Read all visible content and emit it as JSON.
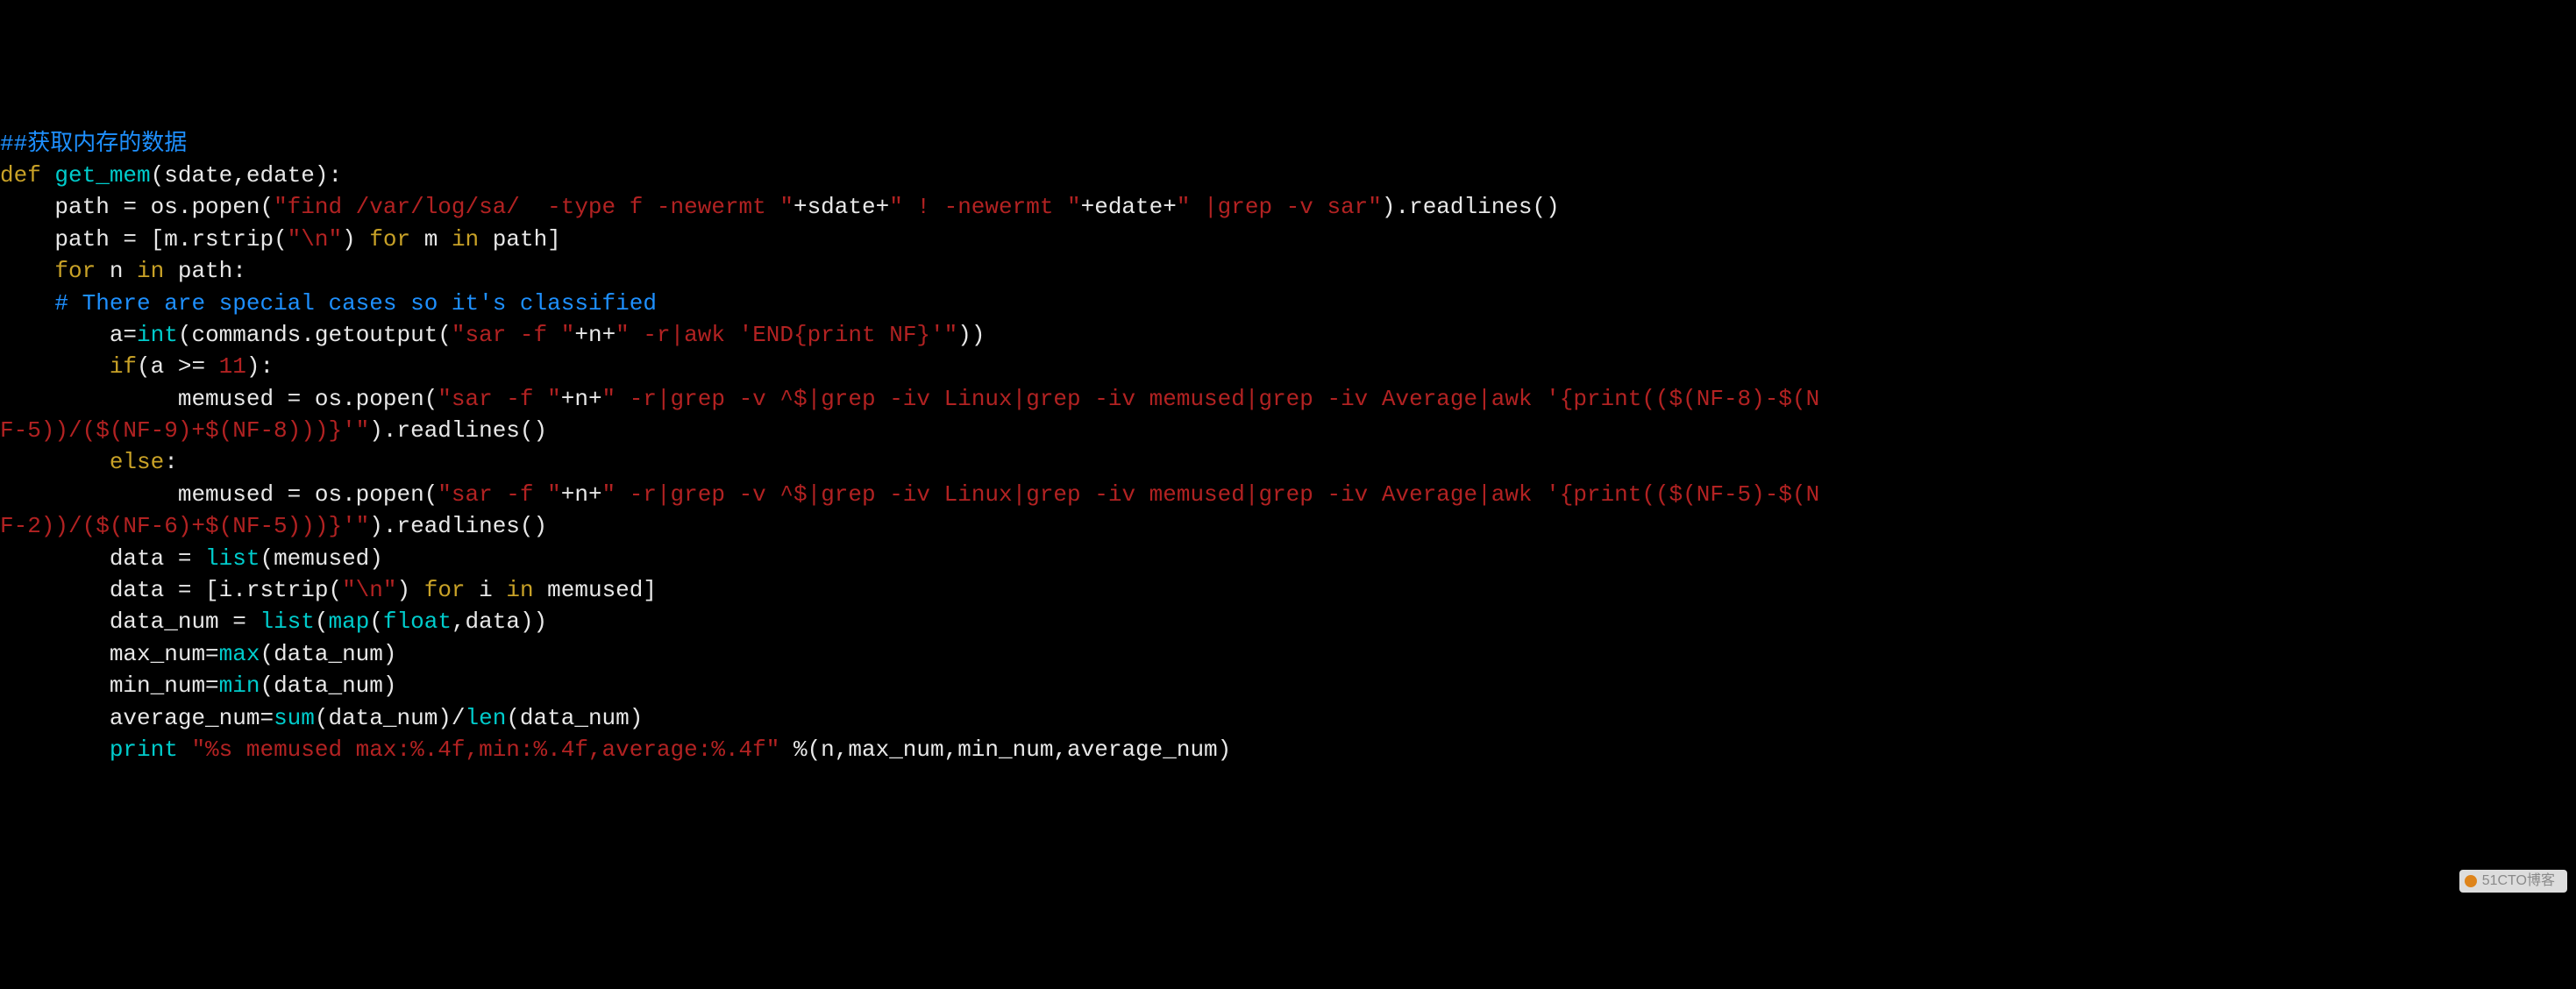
{
  "code": {
    "line1": {
      "comment": "##获取内存的数据"
    },
    "line2": {
      "kw_def": "def",
      "fn": "get_mem",
      "args": "(sdate,edate):"
    },
    "line3": {
      "ind": "    ",
      "lhs": "path = os.popen(",
      "str": "\"find /var/log/sa/  -type f -newermt \"",
      "mid1": "+sdate+",
      "str2": "\" ! -newermt \"",
      "mid2": "+edate+",
      "str3": "\" |grep -v sar\"",
      "tail": ").readlines()"
    },
    "line4": {
      "ind": "    ",
      "lhs": "path = [m.rstrip(",
      "str": "\"\\n\"",
      "mid": ") ",
      "kw_for": "for",
      "mid2": " m ",
      "kw_in": "in",
      "tail": " path]"
    },
    "line5": {
      "ind": "    ",
      "kw_for": "for",
      "mid": " n ",
      "kw_in": "in",
      "tail": " path:"
    },
    "line6": {
      "ind": "    ",
      "comment": "# There are special cases so it's classified"
    },
    "line7": {
      "ind": "        ",
      "lhs": "a=",
      "fn": "int",
      "p1": "(commands.getoutput(",
      "str": "\"sar -f \"",
      "mid": "+n+",
      "str2": "\" -r|awk 'END{print NF}'\"",
      "tail": "))"
    },
    "line8": {
      "ind": "        ",
      "kw_if": "if",
      "p": "(a >= ",
      "num": "11",
      "tail": "):"
    },
    "line9": {
      "ind": "             ",
      "lhs": "memused = os.popen(",
      "str": "\"sar -f \"",
      "mid": "+n+",
      "str2": "\" -r|grep -v ^$|grep -iv Linux|grep -iv memused|grep -iv Average|awk '{print(($(NF-8)-$(N"
    },
    "line10": {
      "str": "F-5))/($(NF-9)+$(NF-8)))}'\"",
      "tail": ").readlines()"
    },
    "line11": {
      "ind": "        ",
      "kw_else": "else",
      "tail": ":"
    },
    "line12": {
      "ind": "             ",
      "lhs": "memused = os.popen(",
      "str": "\"sar -f \"",
      "mid": "+n+",
      "str2": "\" -r|grep -v ^$|grep -iv Linux|grep -iv memused|grep -iv Average|awk '{print(($(NF-5)-$(N"
    },
    "line13": {
      "str": "F-2))/($(NF-6)+$(NF-5)))}'\"",
      "tail": ").readlines()"
    },
    "line14": {
      "ind": "        ",
      "lhs": "data = ",
      "fn": "list",
      "tail": "(memused)"
    },
    "line15": {
      "ind": "        ",
      "lhs": "data = [i.rstrip(",
      "str": "\"\\n\"",
      "mid": ") ",
      "kw_for": "for",
      "mid2": " i ",
      "kw_in": "in",
      "tail": " memused]"
    },
    "line16": {
      "ind": "        ",
      "lhs": "data_num = ",
      "fn": "list",
      "p1": "(",
      "fn2": "map",
      "p2": "(",
      "fn3": "float",
      "tail": ",data))"
    },
    "line17": {
      "ind": "        ",
      "lhs": "max_num=",
      "fn": "max",
      "tail": "(data_num)"
    },
    "line18": {
      "ind": "        ",
      "lhs": "min_num=",
      "fn": "min",
      "tail": "(data_num)"
    },
    "line19": {
      "ind": "        ",
      "lhs": "average_num=",
      "fn": "sum",
      "mid": "(data_num)/",
      "fn2": "len",
      "tail": "(data_num)"
    },
    "line20": {
      "ind": "        ",
      "kw_print": "print",
      "sp": " ",
      "str": "\"%s memused max:%.4f,min:%.4f,average:%.4f\"",
      "tail": " %(n,max_num,min_num,average_num)"
    }
  },
  "watermark": "51CTO博客"
}
